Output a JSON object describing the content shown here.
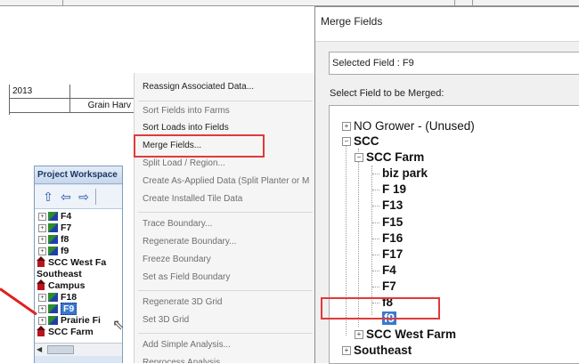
{
  "spreadsheet": {
    "year": "2013",
    "operation": "Grain Harv"
  },
  "workspace": {
    "title": "Project Workspace",
    "toolbar": {
      "up_icon": "up-arrow-icon",
      "back_icon": "back-arrow-icon",
      "forward_icon": "forward-arrow-icon"
    },
    "items": [
      {
        "label": "F4",
        "type": "field"
      },
      {
        "label": "F7",
        "type": "field"
      },
      {
        "label": "f8",
        "type": "field"
      },
      {
        "label": "f9",
        "type": "field"
      },
      {
        "label": "SCC West Fa",
        "type": "farm"
      },
      {
        "label": "Southeast",
        "type": "grower"
      },
      {
        "label": "Campus",
        "type": "farm"
      },
      {
        "label": "F18",
        "type": "field"
      },
      {
        "label": "F9",
        "type": "field",
        "selected": true
      },
      {
        "label": "Prairie Fi",
        "type": "field"
      },
      {
        "label": "SCC Farm",
        "type": "farm"
      }
    ]
  },
  "context_menu": {
    "items": [
      {
        "label": "Reassign Associated Data...",
        "enabled": true
      },
      {
        "label": "Sort Fields into Farms",
        "enabled": false
      },
      {
        "label": "Sort Loads into Fields",
        "enabled": true
      },
      {
        "label": "Merge Fields...",
        "enabled": true,
        "highlighted": true
      },
      {
        "label": "Split Load / Region...",
        "enabled": false
      },
      {
        "label": "Create As-Applied Data (Split Planter or M",
        "enabled": false
      },
      {
        "label": "Create Installed Tile Data",
        "enabled": true
      },
      {
        "label": "Trace Boundary...",
        "enabled": false
      },
      {
        "label": "Regenerate Boundary...",
        "enabled": false
      },
      {
        "label": "Freeze Boundary",
        "enabled": false
      },
      {
        "label": "Set as Field Boundary",
        "enabled": false
      },
      {
        "label": "Regenerate 3D Grid",
        "enabled": false
      },
      {
        "label": "Set 3D Grid",
        "enabled": false
      },
      {
        "label": "Add Simple Analysis...",
        "enabled": false
      },
      {
        "label": "Reprocess Analysis...",
        "enabled": false
      }
    ]
  },
  "dialog": {
    "title": "Merge Fields",
    "selected_field": "Selected Field : F9",
    "select_label": "Select Field to be Merged:",
    "tree": {
      "no_grower": "NO Grower - (Unused)",
      "scc": "SCC",
      "scc_farm": "SCC Farm",
      "fields": [
        "biz park",
        "F 19",
        "F13",
        "F15",
        "F16",
        "F17",
        "F4",
        "F7",
        "f8",
        "f9"
      ],
      "scc_west_farm": "SCC West Farm",
      "southeast": "Southeast"
    },
    "selected_tree_item": "f9"
  },
  "colors": {
    "highlight_box": "#e03a3a",
    "selection": "#3a78d0",
    "workspace_bg": "#dbe6f4",
    "field_icon_green": "#2e8b2e",
    "field_icon_blue": "#1f3fa8",
    "farm_icon_red": "#b8141c"
  }
}
